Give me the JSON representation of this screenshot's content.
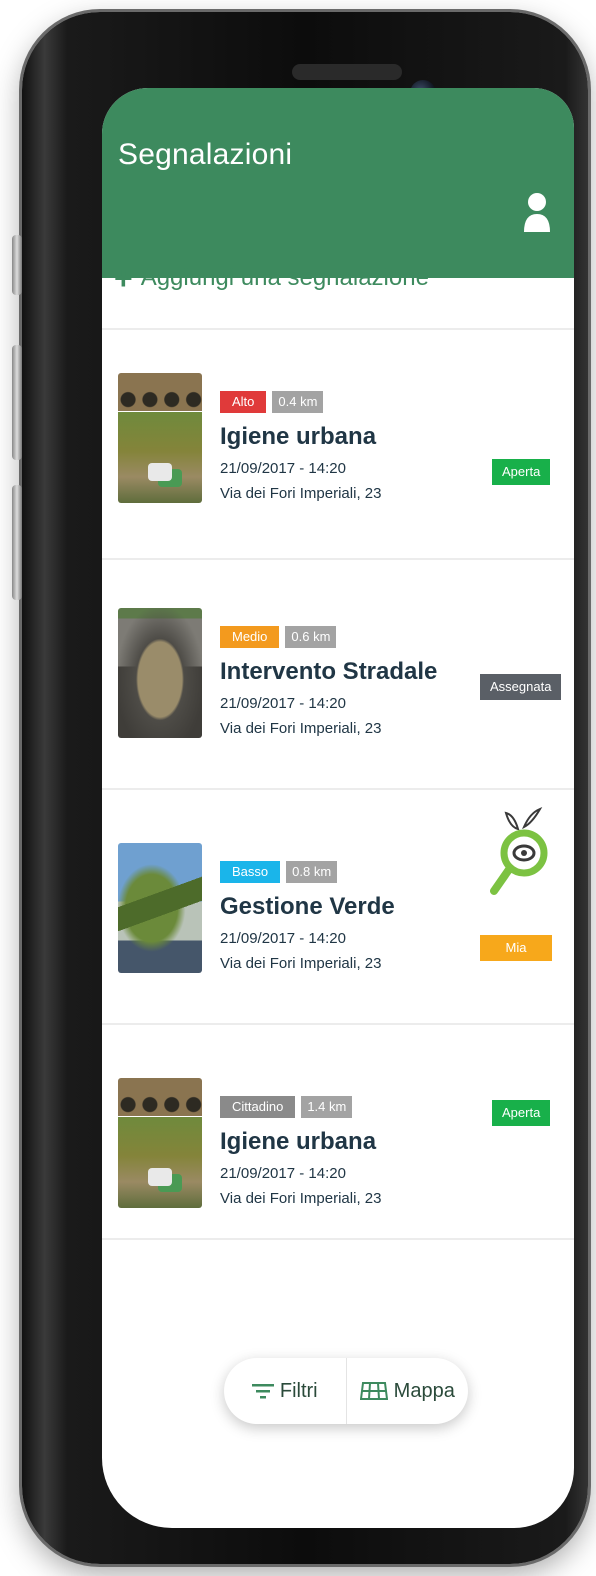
{
  "header": {
    "title": "Segnalazioni",
    "accent_color": "#3d8a5e",
    "profile_icon": "user-icon"
  },
  "add_report": {
    "label": "Aggiungi una segnalazione",
    "icon": "plus-icon"
  },
  "reports": [
    {
      "priority": "Alto",
      "priority_color": "#e03a3a",
      "distance": "0.4 km",
      "title": "Igiene urbana",
      "datetime": "21/09/2017 - 14:20",
      "address": "Via dei Fori Imperiali, 23",
      "status": "Aperta",
      "status_color": "#18b04a"
    },
    {
      "priority": "Medio",
      "priority_color": "#f39a1e",
      "distance": "0.6 km",
      "title": "Intervento Stradale",
      "datetime": "21/09/2017 - 14:20",
      "address": "Via dei Fori Imperiali, 23",
      "status": "Assegnata",
      "status_color": "#5a5f66"
    },
    {
      "priority": "Basso",
      "priority_color": "#1ab5ea",
      "distance": "0.8 km",
      "title": "Gestione Verde",
      "datetime": "21/09/2017 - 14:20",
      "address": "Via dei Fori Imperiali, 23",
      "status": "Mia",
      "status_color": "#f7a81b",
      "status_icon": "magnifier-eye-icon"
    },
    {
      "priority": "Cittadino",
      "priority_color": "#8a8a8a",
      "distance": "1.4 km",
      "title": "Igiene urbana",
      "datetime": "21/09/2017 - 14:20",
      "address": "Via dei Fori Imperiali, 23",
      "status": "Aperta",
      "status_color": "#18b04a"
    }
  ],
  "bottom_bar": {
    "filters_label": "Filtri",
    "filters_icon": "filter-icon",
    "map_label": "Mappa",
    "map_icon": "map-icon"
  }
}
